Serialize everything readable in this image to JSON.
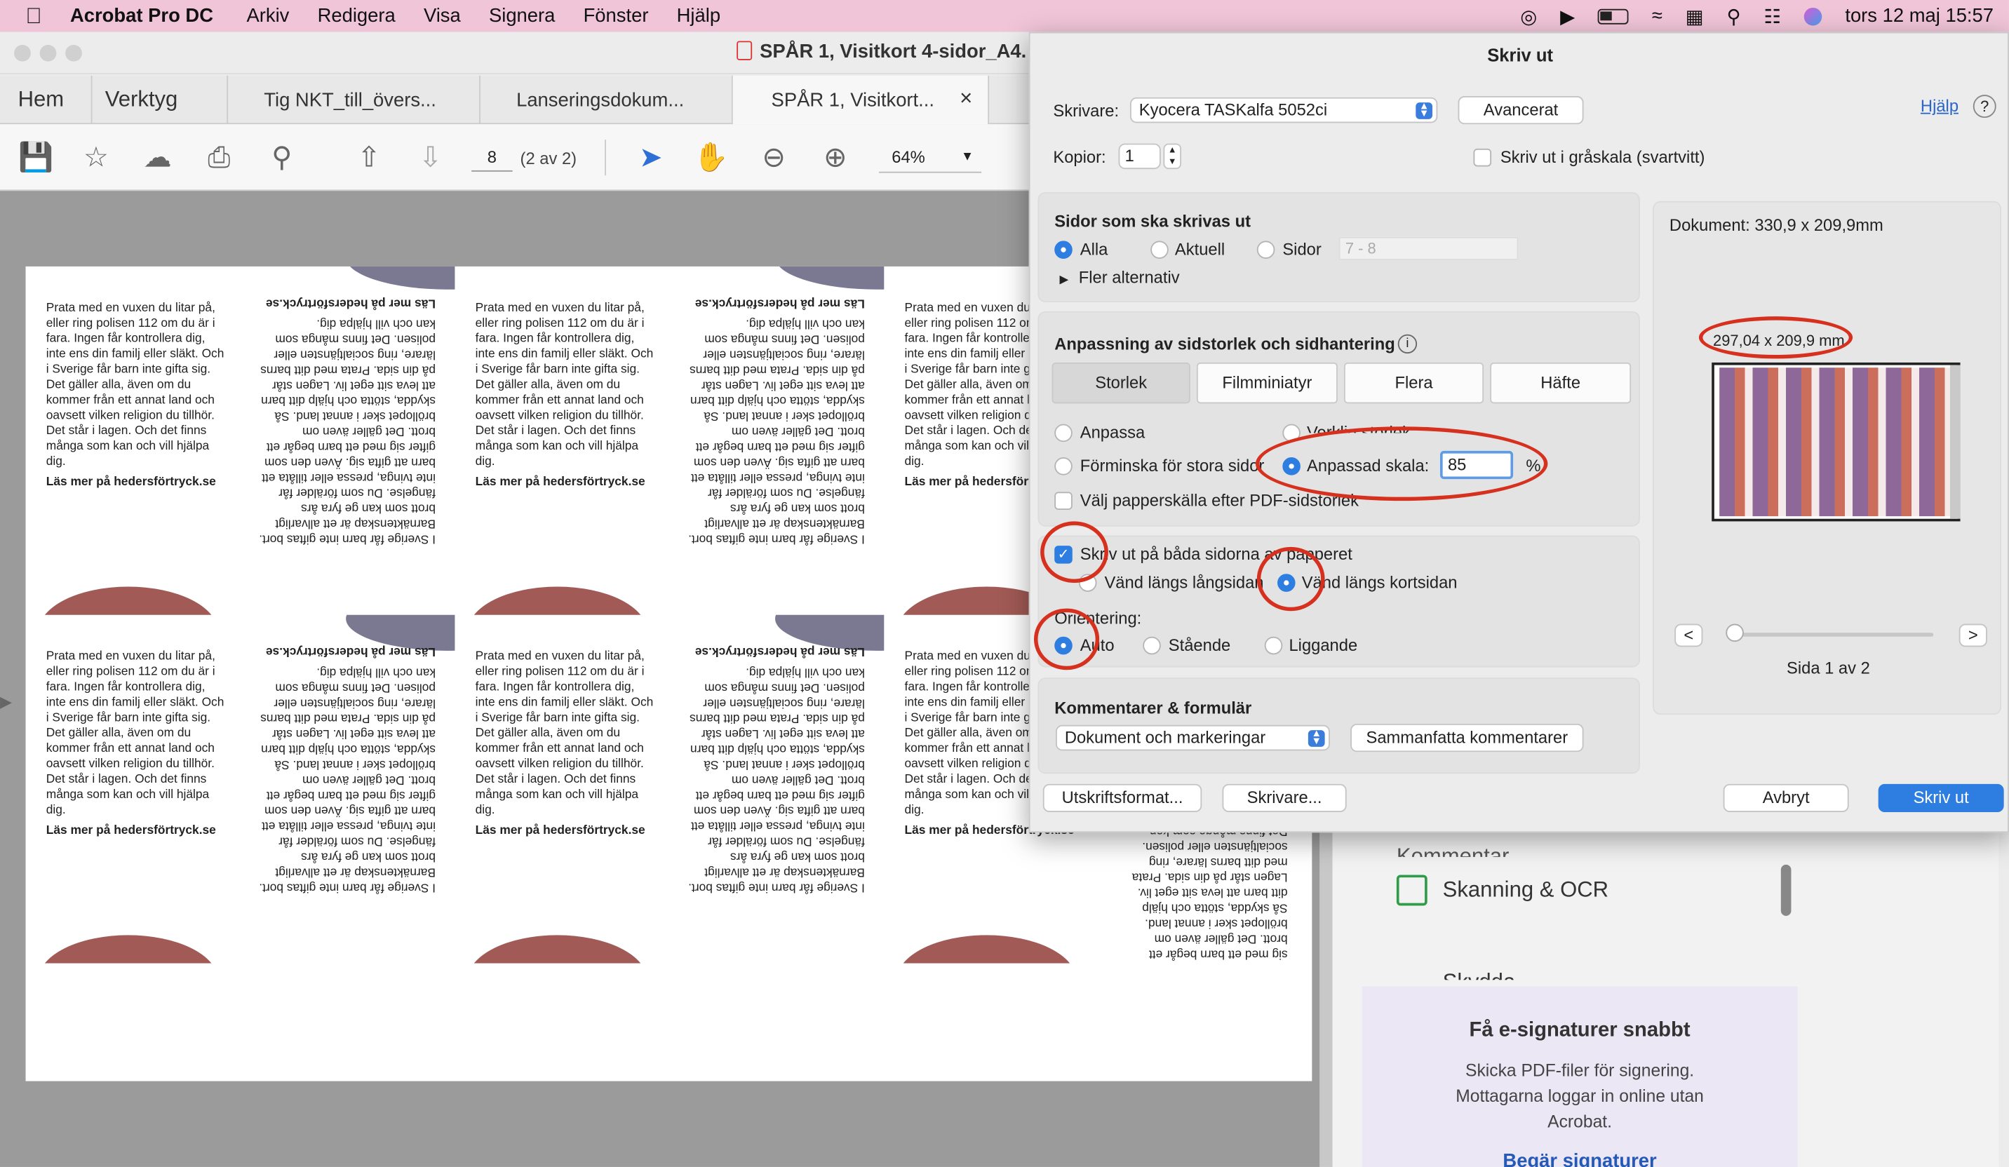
{
  "menubar": {
    "app": "Acrobat Pro DC",
    "items": [
      "Arkiv",
      "Redigera",
      "Visa",
      "Signera",
      "Fönster",
      "Hjälp"
    ],
    "clock": "tors 12 maj  15:57"
  },
  "window": {
    "title": "SPÅR 1, Visitkort 4-sidor_A4.",
    "tabs": [
      "Hem",
      "Verktyg",
      "Tig NKT_till_övers...",
      "Lanseringsdokum...",
      "SPÅR 1, Visitkort..."
    ],
    "close": "×"
  },
  "toolbar": {
    "page": "8",
    "page_of": "(2 av 2)",
    "zoom": "64%"
  },
  "card": {
    "text": "Prata med en vuxen du litar på, eller ring polisen 112 om du är i fara. Ingen får kontrollera dig, inte ens din familj eller släkt. Och i Sverige får barn inte gifta sig. Det gäller alla, även om du kommer från ett annat land och oavsett vilken religion du tillhör. Det står i lagen. Och det finns många som kan och vill hjälpa dig.",
    "link": "Läs mer på hedersförtryck.se",
    "flip_text": "I Sverige får barn inte giftas bort. Barnäktenskap är ett allvarligt brott som kan ge fyra års fängelse. Du som förälder får inte tvinga, pressa eller tillåta ett barn att gifta sig. Även den som gifter sig med ett barn begår ett brott. Det gäller även om bröllopet sker i annat land. Så skydda, stötta och hjälp ditt barn att leva sitt eget liv. Lagen står på din sida. Prata med ditt barns lärare, ring socialtjänsten eller polisen. Det finns många som kan och vill hjälpa dig."
  },
  "rightpanel": {
    "scan": "Skanning & OCR",
    "hidden": "Skydda",
    "comment": "Kommentar",
    "esig_title": "Få e-signaturer snabbt",
    "esig_body": "Skicka PDF-filer för signering. Mottagarna loggar in online utan Acrobat.",
    "esig_link": "Begär signaturer"
  },
  "dialog": {
    "title": "Skriv ut",
    "printer_label": "Skrivare:",
    "printer": "Kyocera TASKalfa 5052ci",
    "advanced": "Avancerat",
    "help": "Hjälp",
    "help_q": "?",
    "copies_label": "Kopior:",
    "copies": "1",
    "grayscale": "Skriv ut i gråskala (svartvitt)",
    "pages": {
      "heading": "Sidor som ska skrivas ut",
      "all": "Alla",
      "current": "Aktuell",
      "pages": "Sidor",
      "range_ph": "7 - 8",
      "more": "Fler alternativ"
    },
    "sizing": {
      "heading": "Anpassning av sidstorlek och sidhantering",
      "info": "i",
      "tabs": [
        "Storlek",
        "Filmminiatyr",
        "Flera",
        "Häfte"
      ],
      "fit": "Anpassa",
      "actual": "Verklig storlek",
      "shrink": "Förminska för stora sidor",
      "custom": "Anpassad skala:",
      "scale": "85",
      "pct": "%",
      "source": "Välj papperskälla efter PDF-sidstorlek"
    },
    "duplex": {
      "both": "Skriv ut på båda sidorna av papperet",
      "long": "Vänd längs långsidan",
      "short": "Vänd längs kortsidan",
      "orient": "Orientering:",
      "auto": "Auto",
      "portrait": "Stående",
      "landscape": "Liggande"
    },
    "comments": {
      "heading": "Kommentarer & formulär",
      "value": "Dokument och markeringar",
      "summarize": "Sammanfatta kommentarer"
    },
    "preview": {
      "doc": "Dokument:  330,9 x 209,9mm",
      "paper": "297,04 x 209,9 mm",
      "prev": "<",
      "next": ">",
      "page": "Sida 1 av 2"
    },
    "footer": {
      "setup": "Utskriftsformat...",
      "printer": "Skrivare...",
      "cancel": "Avbryt",
      "print": "Skriv ut"
    }
  },
  "colors": {
    "menubar": "#f0c5d7",
    "accent": "#2e7de0",
    "annotation": "#d6311f",
    "arc_red": "#a15a55",
    "arc_purple": "#7b7892"
  }
}
